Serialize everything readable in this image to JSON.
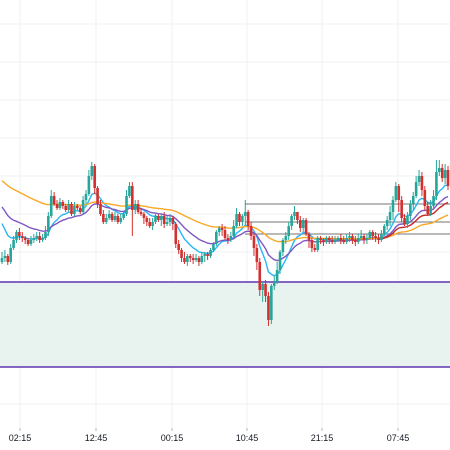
{
  "chart_data": {
    "type": "candlestick",
    "grid": true,
    "x_ticks": [
      "02:15",
      "12:45",
      "00:15",
      "10:45",
      "21:15",
      "07:45"
    ],
    "colors": {
      "up": "#26a69a",
      "down": "#d32f2f",
      "ma_fast": "#29b6f6",
      "ma_mid": "#7e57c2",
      "ma_slow": "#f9a825",
      "ma_red": "#c62828",
      "zone_line": "#5e35b1",
      "zone_fill": "#e8f3ef",
      "level_line": "#757575"
    },
    "zone": {
      "top": 282,
      "bottom": 367
    },
    "levels": [
      204,
      222,
      234
    ],
    "candles": [
      [
        262,
        258,
        252,
        264
      ],
      [
        258,
        256,
        250,
        262
      ],
      [
        256,
        262,
        254,
        265
      ],
      [
        262,
        248,
        244,
        264
      ],
      [
        248,
        240,
        236,
        250
      ],
      [
        240,
        232,
        230,
        243
      ],
      [
        232,
        236,
        228,
        240
      ],
      [
        236,
        238,
        232,
        242
      ],
      [
        238,
        240,
        236,
        244
      ],
      [
        240,
        244,
        238,
        246
      ],
      [
        244,
        240,
        236,
        246
      ],
      [
        240,
        238,
        234,
        243
      ],
      [
        238,
        236,
        232,
        241
      ],
      [
        236,
        240,
        232,
        243
      ],
      [
        240,
        238,
        234,
        242
      ],
      [
        238,
        232,
        226,
        240
      ],
      [
        232,
        216,
        212,
        236
      ],
      [
        216,
        196,
        190,
        218
      ],
      [
        196,
        204,
        192,
        206
      ],
      [
        204,
        208,
        200,
        210
      ],
      [
        208,
        202,
        198,
        210
      ],
      [
        202,
        206,
        200,
        209
      ],
      [
        206,
        210,
        204,
        212
      ],
      [
        210,
        204,
        200,
        212
      ],
      [
        204,
        214,
        202,
        216
      ],
      [
        214,
        206,
        202,
        216
      ],
      [
        206,
        208,
        204,
        210
      ],
      [
        208,
        212,
        206,
        214
      ],
      [
        212,
        200,
        196,
        214
      ],
      [
        200,
        194,
        190,
        204
      ],
      [
        194,
        176,
        170,
        196
      ],
      [
        176,
        166,
        162,
        180
      ],
      [
        166,
        188,
        164,
        194
      ],
      [
        188,
        204,
        186,
        208
      ],
      [
        204,
        214,
        200,
        216
      ],
      [
        214,
        222,
        210,
        224
      ],
      [
        222,
        218,
        214,
        224
      ],
      [
        218,
        214,
        210,
        220
      ],
      [
        214,
        220,
        212,
        222
      ],
      [
        220,
        216,
        212,
        222
      ],
      [
        216,
        222,
        214,
        224
      ],
      [
        222,
        218,
        214,
        224
      ],
      [
        218,
        214,
        212,
        220
      ],
      [
        214,
        196,
        190,
        216
      ],
      [
        196,
        186,
        182,
        198
      ],
      [
        186,
        210,
        182,
        236
      ],
      [
        210,
        204,
        200,
        214
      ],
      [
        204,
        212,
        200,
        214
      ],
      [
        212,
        214,
        208,
        216
      ],
      [
        214,
        218,
        212,
        224
      ],
      [
        218,
        222,
        216,
        226
      ],
      [
        222,
        226,
        218,
        228
      ],
      [
        226,
        222,
        218,
        230
      ],
      [
        222,
        216,
        214,
        224
      ],
      [
        216,
        220,
        214,
        222
      ],
      [
        220,
        216,
        214,
        226
      ],
      [
        216,
        224,
        212,
        228
      ],
      [
        224,
        222,
        216,
        226
      ],
      [
        222,
        218,
        214,
        226
      ],
      [
        218,
        224,
        216,
        230
      ],
      [
        224,
        244,
        222,
        248
      ],
      [
        244,
        250,
        240,
        254
      ],
      [
        250,
        258,
        248,
        262
      ],
      [
        258,
        262,
        252,
        264
      ],
      [
        262,
        256,
        254,
        266
      ],
      [
        256,
        258,
        254,
        262
      ],
      [
        258,
        260,
        254,
        264
      ],
      [
        260,
        258,
        254,
        262
      ],
      [
        258,
        262,
        256,
        266
      ],
      [
        262,
        256,
        252,
        264
      ],
      [
        256,
        254,
        252,
        262
      ],
      [
        254,
        256,
        252,
        260
      ],
      [
        256,
        250,
        248,
        258
      ],
      [
        250,
        244,
        242,
        252
      ],
      [
        244,
        232,
        230,
        246
      ],
      [
        232,
        228,
        226,
        236
      ],
      [
        228,
        230,
        224,
        236
      ],
      [
        230,
        238,
        226,
        240
      ],
      [
        238,
        240,
        234,
        244
      ],
      [
        240,
        236,
        232,
        242
      ],
      [
        236,
        226,
        220,
        238
      ],
      [
        226,
        214,
        208,
        228
      ],
      [
        214,
        222,
        212,
        226
      ],
      [
        222,
        216,
        214,
        226
      ],
      [
        216,
        212,
        200,
        226
      ],
      [
        212,
        226,
        210,
        230
      ],
      [
        226,
        236,
        222,
        240
      ],
      [
        236,
        248,
        234,
        256
      ],
      [
        248,
        262,
        244,
        270
      ],
      [
        262,
        290,
        258,
        296
      ],
      [
        290,
        284,
        282,
        302
      ],
      [
        284,
        296,
        280,
        302
      ],
      [
        296,
        320,
        292,
        326
      ],
      [
        320,
        286,
        284,
        324
      ],
      [
        286,
        282,
        276,
        290
      ],
      [
        282,
        270,
        262,
        284
      ],
      [
        270,
        252,
        250,
        274
      ],
      [
        252,
        240,
        238,
        256
      ],
      [
        240,
        236,
        232,
        244
      ],
      [
        236,
        226,
        222,
        240
      ],
      [
        226,
        216,
        214,
        230
      ],
      [
        216,
        212,
        206,
        220
      ],
      [
        212,
        220,
        212,
        224
      ],
      [
        220,
        228,
        216,
        232
      ],
      [
        228,
        220,
        218,
        232
      ],
      [
        220,
        234,
        218,
        236
      ],
      [
        234,
        240,
        232,
        248
      ],
      [
        240,
        248,
        238,
        252
      ],
      [
        248,
        250,
        244,
        252
      ],
      [
        250,
        238,
        236,
        252
      ],
      [
        238,
        240,
        236,
        244
      ],
      [
        240,
        242,
        238,
        246
      ],
      [
        242,
        238,
        236,
        244
      ],
      [
        238,
        240,
        236,
        244
      ],
      [
        240,
        242,
        236,
        244
      ],
      [
        242,
        240,
        236,
        244
      ],
      [
        240,
        238,
        236,
        242
      ],
      [
        238,
        240,
        234,
        244
      ],
      [
        240,
        242,
        236,
        244
      ],
      [
        242,
        238,
        234,
        244
      ],
      [
        238,
        236,
        232,
        242
      ],
      [
        236,
        240,
        234,
        244
      ],
      [
        240,
        242,
        236,
        246
      ],
      [
        242,
        238,
        234,
        244
      ],
      [
        238,
        236,
        230,
        240
      ],
      [
        236,
        240,
        234,
        244
      ],
      [
        240,
        238,
        234,
        244
      ],
      [
        238,
        232,
        230,
        240
      ],
      [
        232,
        236,
        230,
        240
      ],
      [
        236,
        238,
        232,
        242
      ],
      [
        238,
        240,
        234,
        244
      ],
      [
        240,
        234,
        230,
        242
      ],
      [
        234,
        226,
        224,
        236
      ],
      [
        226,
        220,
        216,
        230
      ],
      [
        220,
        212,
        206,
        226
      ],
      [
        212,
        200,
        196,
        220
      ],
      [
        200,
        186,
        182,
        202
      ],
      [
        186,
        200,
        184,
        212
      ],
      [
        200,
        218,
        196,
        222
      ],
      [
        218,
        224,
        214,
        226
      ],
      [
        224,
        216,
        212,
        228
      ],
      [
        216,
        204,
        200,
        220
      ],
      [
        204,
        196,
        192,
        210
      ],
      [
        196,
        182,
        176,
        198
      ],
      [
        182,
        176,
        170,
        186
      ],
      [
        176,
        190,
        172,
        196
      ],
      [
        190,
        206,
        186,
        210
      ],
      [
        206,
        214,
        202,
        216
      ],
      [
        214,
        206,
        200,
        216
      ],
      [
        206,
        196,
        190,
        210
      ],
      [
        196,
        172,
        160,
        200
      ],
      [
        172,
        168,
        160,
        176
      ],
      [
        168,
        178,
        164,
        182
      ],
      [
        178,
        170,
        164,
        184
      ],
      [
        170,
        186,
        166,
        190
      ]
    ]
  }
}
